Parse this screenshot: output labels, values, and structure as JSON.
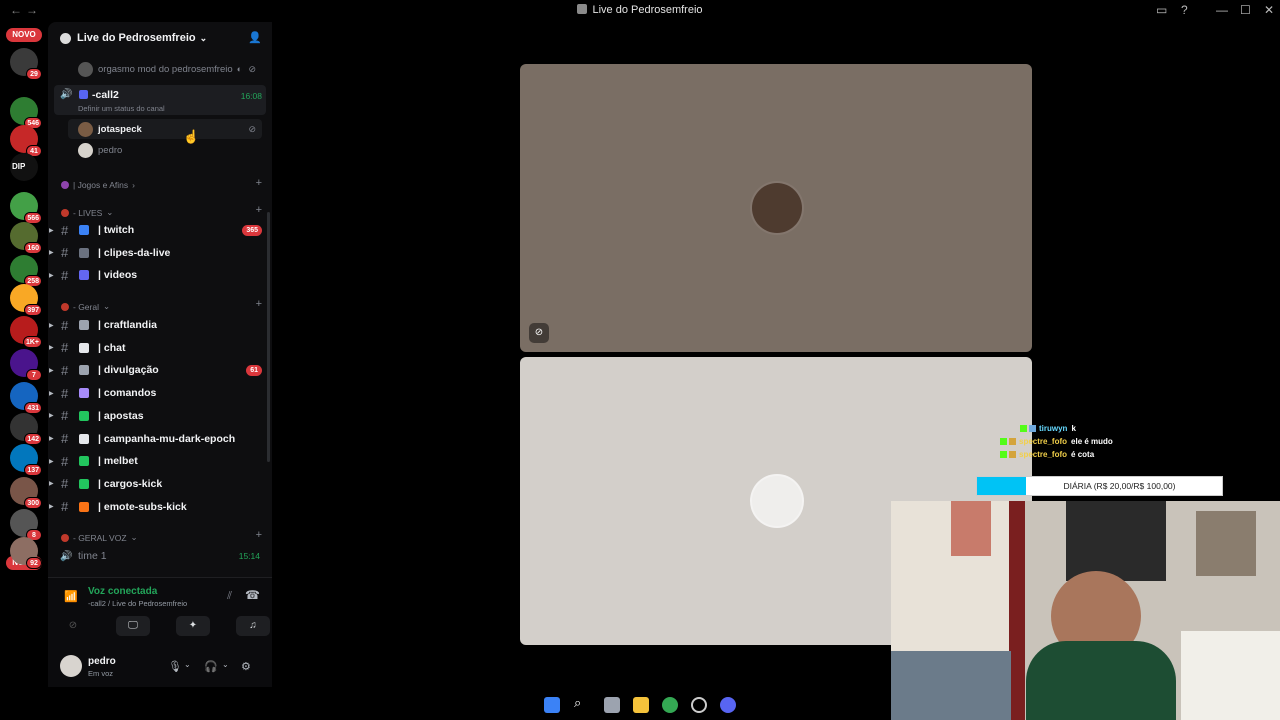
{
  "window": {
    "title": "Live do Pedrosemfreio"
  },
  "rail": {
    "novo_top": "NOVO",
    "novo_bottom": "NOVO",
    "servers": [
      {
        "badge": "29",
        "color": "#3a3a3a"
      },
      {
        "badge": "546",
        "color": "#2e7d32"
      },
      {
        "badge": "41",
        "color": "#c62828"
      },
      {
        "badge": "",
        "color": "#111111",
        "text": "DIP"
      },
      {
        "badge": "566",
        "color": "#43a047"
      },
      {
        "badge": "160",
        "color": "#556b2f"
      },
      {
        "badge": "258",
        "color": "#2e7d32"
      },
      {
        "badge": "397",
        "color": "#f9a825"
      },
      {
        "badge": "1K+",
        "color": "#b71c1c"
      },
      {
        "badge": "7",
        "color": "#4a148c"
      },
      {
        "badge": "431",
        "color": "#1565c0"
      },
      {
        "badge": "142",
        "color": "#333333"
      },
      {
        "badge": "137",
        "color": "#0277bd"
      },
      {
        "badge": "300",
        "color": "#795548"
      },
      {
        "badge": "8",
        "color": "#555555"
      },
      {
        "badge": "92",
        "color": "#8d6e63"
      }
    ]
  },
  "guild": {
    "name": "Live do Pedrosemfreio"
  },
  "voice_members_top": {
    "name": "orgasmo mod do pedrosemfreio"
  },
  "call2": {
    "name": "-call2",
    "status": "Definir um status do canal",
    "timer": "16:08"
  },
  "call2_members": [
    {
      "name": "jotaspeck"
    },
    {
      "name": "pedro"
    }
  ],
  "categories": {
    "jogos": "| Jogos e Afins",
    "lives": "- LIVES",
    "geral": "- Geral",
    "geral_voz": "- GERAL VOZ"
  },
  "lives_channels": [
    {
      "label": "| twitch",
      "badge": "365",
      "color": "#3b82f6"
    },
    {
      "label": "| clipes-da-live",
      "badge": "",
      "color": "#6b7280"
    },
    {
      "label": "| videos",
      "badge": "",
      "color": "#6366f1"
    }
  ],
  "geral_channels": [
    {
      "label": "| craftlandia",
      "badge": "",
      "color": "#9ca3af"
    },
    {
      "label": "| chat",
      "badge": "",
      "color": "#e5e7eb"
    },
    {
      "label": "| divulgação",
      "badge": "61",
      "color": "#9ca3af"
    },
    {
      "label": "| comandos",
      "badge": "",
      "color": "#a78bfa"
    },
    {
      "label": "| apostas",
      "badge": "",
      "color": "#22c55e"
    },
    {
      "label": "| campanha-mu-dark-epoch",
      "badge": "",
      "color": "#e5e7eb"
    },
    {
      "label": "| melbet",
      "badge": "",
      "color": "#22c55e"
    },
    {
      "label": "| cargos-kick",
      "badge": "",
      "color": "#22c55e"
    },
    {
      "label": "| emote-subs-kick",
      "badge": "",
      "color": "#f97316"
    }
  ],
  "voice_channel_time1": {
    "name": "time 1",
    "timer": "15:14"
  },
  "voice_panel": {
    "status": "Voz conectada",
    "location": "-call2 / Live do Pedrosemfreio"
  },
  "user_panel": {
    "name": "pedro",
    "status": "Em voz"
  },
  "overlay_chat": [
    {
      "nick": "tiruwyn",
      "msg": "k",
      "nick_color": "#66d9ff"
    },
    {
      "nick": "spectre_fofo",
      "msg": "ele é mudo",
      "nick_color": "#f2d04a"
    },
    {
      "nick": "spectre_fofo",
      "msg": "é cota",
      "nick_color": "#f2d04a"
    }
  ],
  "goal": {
    "label": "DIÁRIA (R$ 20,00/R$ 100,00)",
    "progress": 0.2
  }
}
